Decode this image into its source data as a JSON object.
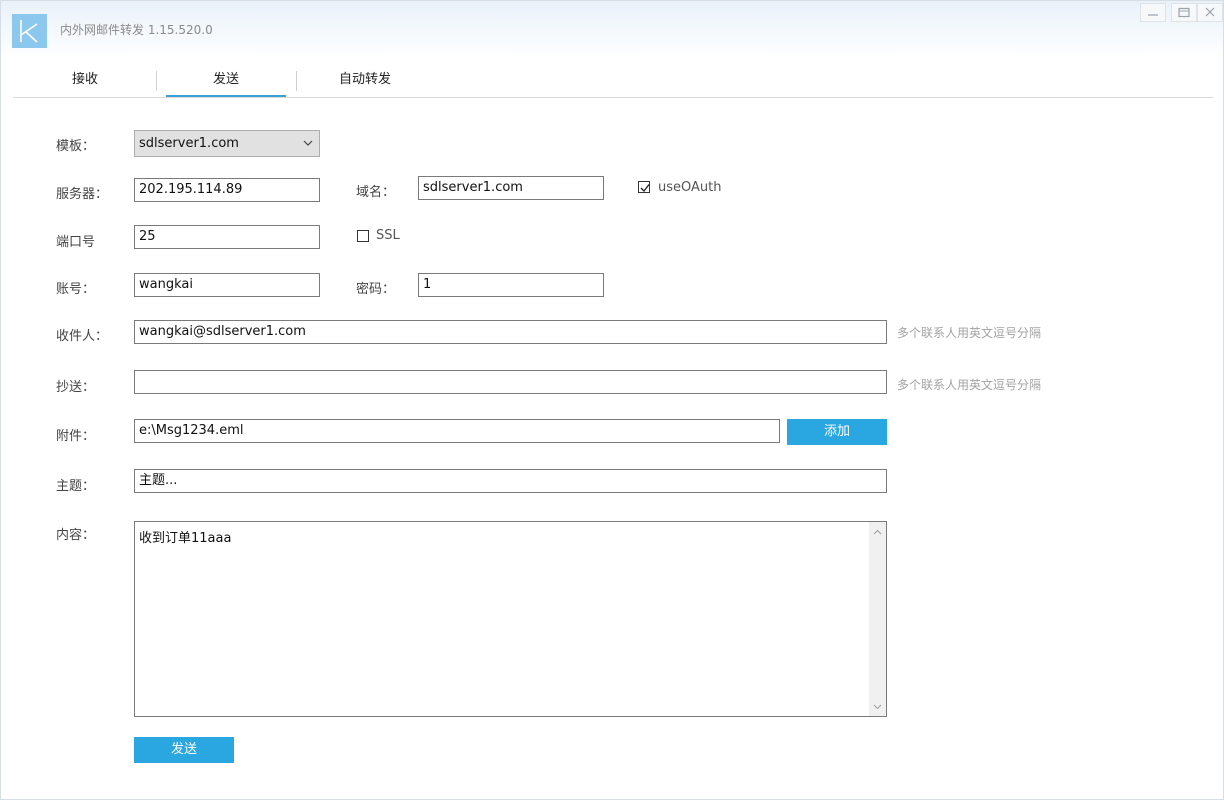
{
  "window": {
    "title": "内外网邮件转发 1.15.520.0"
  },
  "tabs": [
    {
      "label": "接收"
    },
    {
      "label": "发送"
    },
    {
      "label": "自动转发"
    }
  ],
  "form": {
    "template": {
      "label": "模板：",
      "value": "sdlserver1.com"
    },
    "server": {
      "label": "服务器：",
      "value": "202.195.114.89"
    },
    "domain": {
      "label": "域名：",
      "value": "sdlserver1.com"
    },
    "use_oauth": {
      "label": "useOAuth",
      "checked": true
    },
    "port": {
      "label": "端口号",
      "value": "25"
    },
    "ssl": {
      "label": "SSL",
      "checked": false
    },
    "account": {
      "label": "账号：",
      "value": "wangkai"
    },
    "password": {
      "label": "密码：",
      "value": "1"
    },
    "recipient": {
      "label": "收件人：",
      "value": "wangkai@sdlserver1.com",
      "hint": "多个联系人用英文逗号分隔"
    },
    "cc": {
      "label": "抄送：",
      "value": "",
      "hint": "多个联系人用英文逗号分隔"
    },
    "attachment": {
      "label": "附件：",
      "value": "e:\\Msg1234.eml",
      "add_label": "添加"
    },
    "subject": {
      "label": "主题：",
      "value": "主题..."
    },
    "content": {
      "label": "内容：",
      "value": "收到订单11aaa"
    },
    "send_label": "发送"
  },
  "colors": {
    "accent": "#2aa6e0",
    "logo": "#8cc8ee"
  }
}
